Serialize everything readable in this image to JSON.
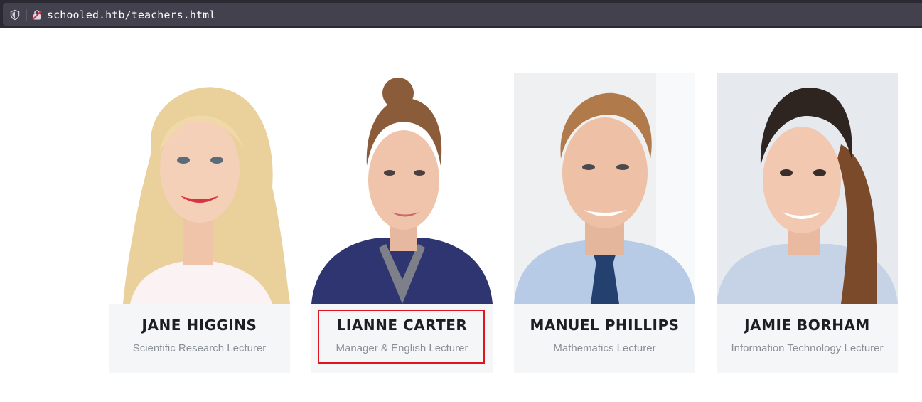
{
  "browser": {
    "url": "schooled.htb/teachers.html",
    "shield_icon": "shield-icon",
    "insecure_icon": "insecure-lock-icon"
  },
  "teachers": [
    {
      "name": "JANE HIGGINS",
      "role": "Scientific Research Lecturer"
    },
    {
      "name": "LIANNE CARTER",
      "role": "Manager & English Lecturer"
    },
    {
      "name": "MANUEL PHILLIPS",
      "role": "Mathematics Lecturer"
    },
    {
      "name": "JAMIE BORHAM",
      "role": "Information Technology Lecturer"
    }
  ],
  "colors": {
    "card_bg": "#f5f6f8",
    "name": "#1e1e22",
    "role": "#8a8f96",
    "highlight": "#e0141e"
  }
}
